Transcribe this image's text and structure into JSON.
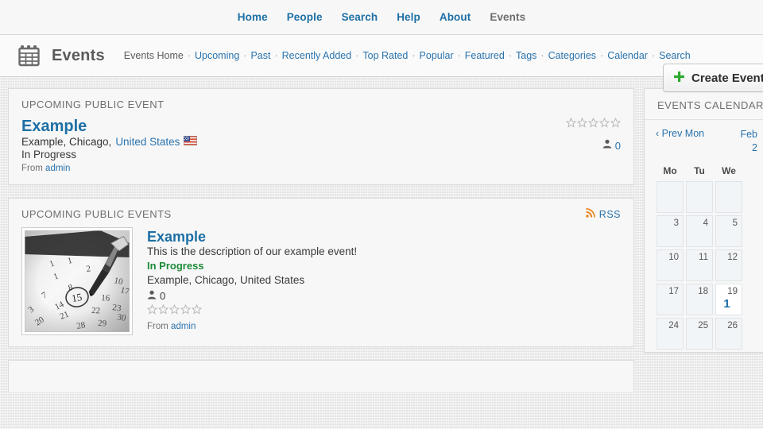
{
  "topnav": {
    "items": [
      {
        "label": "Home",
        "active": false
      },
      {
        "label": "People",
        "active": false
      },
      {
        "label": "Search",
        "active": false
      },
      {
        "label": "Help",
        "active": false
      },
      {
        "label": "About",
        "active": false
      },
      {
        "label": "Events",
        "active": true
      }
    ]
  },
  "apphead": {
    "icon": "calendar-icon",
    "title": "Events",
    "crumbs": [
      "Events Home",
      "Upcoming",
      "Past",
      "Recently Added",
      "Top Rated",
      "Popular",
      "Featured",
      "Tags",
      "Categories",
      "Calendar",
      "Search"
    ],
    "separator": "·",
    "create_button": {
      "icon": "plus-icon",
      "label": "Create Event"
    }
  },
  "featured_panel": {
    "heading": "UPCOMING PUBLIC EVENT",
    "event": {
      "title": "Example",
      "location_prefix": "Example, Chicago,",
      "location_link": "United States",
      "flag_icon": "us-flag-icon",
      "status": "In Progress",
      "from_label": "From",
      "from_user": "admin",
      "rating": 0,
      "rating_max": 5,
      "attendee_icon": "person-icon",
      "attendees": "0"
    }
  },
  "list_panel": {
    "heading": "UPCOMING PUBLIC EVENTS",
    "rss": {
      "icon": "rss-icon",
      "label": "RSS"
    },
    "items": [
      {
        "thumb_alt": "calendar-photo-thumbnail",
        "title": "Example",
        "description": "This is the description of our example event!",
        "status": "In Progress",
        "location": "Example, Chicago, United States",
        "attendee_icon": "person-icon",
        "attendees": "0",
        "rating": 0,
        "rating_max": 5,
        "from_label": "From",
        "from_user": "admin"
      }
    ]
  },
  "sidebar": {
    "heading": "EVENTS CALENDAR",
    "prev_label": "‹ Prev Mon",
    "month": "Feb",
    "year": "2",
    "weekdays": [
      "Mo",
      "Tu",
      "We"
    ],
    "weeks": [
      [
        {
          "day": "",
          "count": ""
        },
        {
          "day": "",
          "count": ""
        },
        {
          "day": "",
          "count": ""
        }
      ],
      [
        {
          "day": "3",
          "count": ""
        },
        {
          "day": "4",
          "count": ""
        },
        {
          "day": "5",
          "count": ""
        }
      ],
      [
        {
          "day": "10",
          "count": ""
        },
        {
          "day": "11",
          "count": ""
        },
        {
          "day": "12",
          "count": ""
        }
      ],
      [
        {
          "day": "17",
          "count": ""
        },
        {
          "day": "18",
          "count": ""
        },
        {
          "day": "19",
          "count": "1",
          "today": true
        }
      ],
      [
        {
          "day": "24",
          "count": ""
        },
        {
          "day": "25",
          "count": ""
        },
        {
          "day": "26",
          "count": ""
        }
      ]
    ]
  },
  "colors": {
    "link": "#2a73ad",
    "title_link": "#1d6fa5",
    "green_status": "#1e8b3a",
    "plus_green": "#2eab2e",
    "rss_orange": "#e8861d",
    "page_bg": "#e9e9e9",
    "panel_bg": "#f7f7f7"
  }
}
